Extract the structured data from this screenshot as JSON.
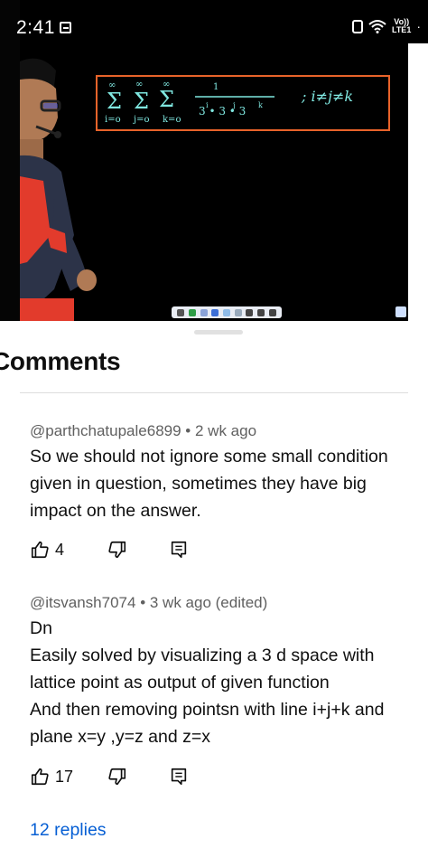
{
  "status_bar": {
    "time": "2:41",
    "network_label": "Vo))\nLTE1"
  },
  "video": {
    "board_conditions": "; i≠j≠k"
  },
  "comments": {
    "title": "Comments",
    "items": [
      {
        "author": "@parthchatupale6899",
        "age": "2 wk ago",
        "text": "So we should not ignore some small condition given in question, sometimes they have big impact on the answer.",
        "likes": "4"
      },
      {
        "author": "@itsvansh7074",
        "age": "3 wk ago (edited)",
        "text": "Dn\nEasily solved by visualizing a 3 d space with lattice point as output of given function\nAnd then removing pointsn with line i+j+k and plane x=y ,y=z and z=x",
        "likes": "17"
      }
    ],
    "replies_label": "12 replies"
  },
  "colors": {
    "accent_blue": "#065fd4",
    "board_border": "#e8632a",
    "chalk": "#7fe7e0"
  },
  "icons": [
    "like-icon",
    "dislike-icon",
    "reply-icon",
    "wifi-icon",
    "lock-icon",
    "notification-icon"
  ]
}
